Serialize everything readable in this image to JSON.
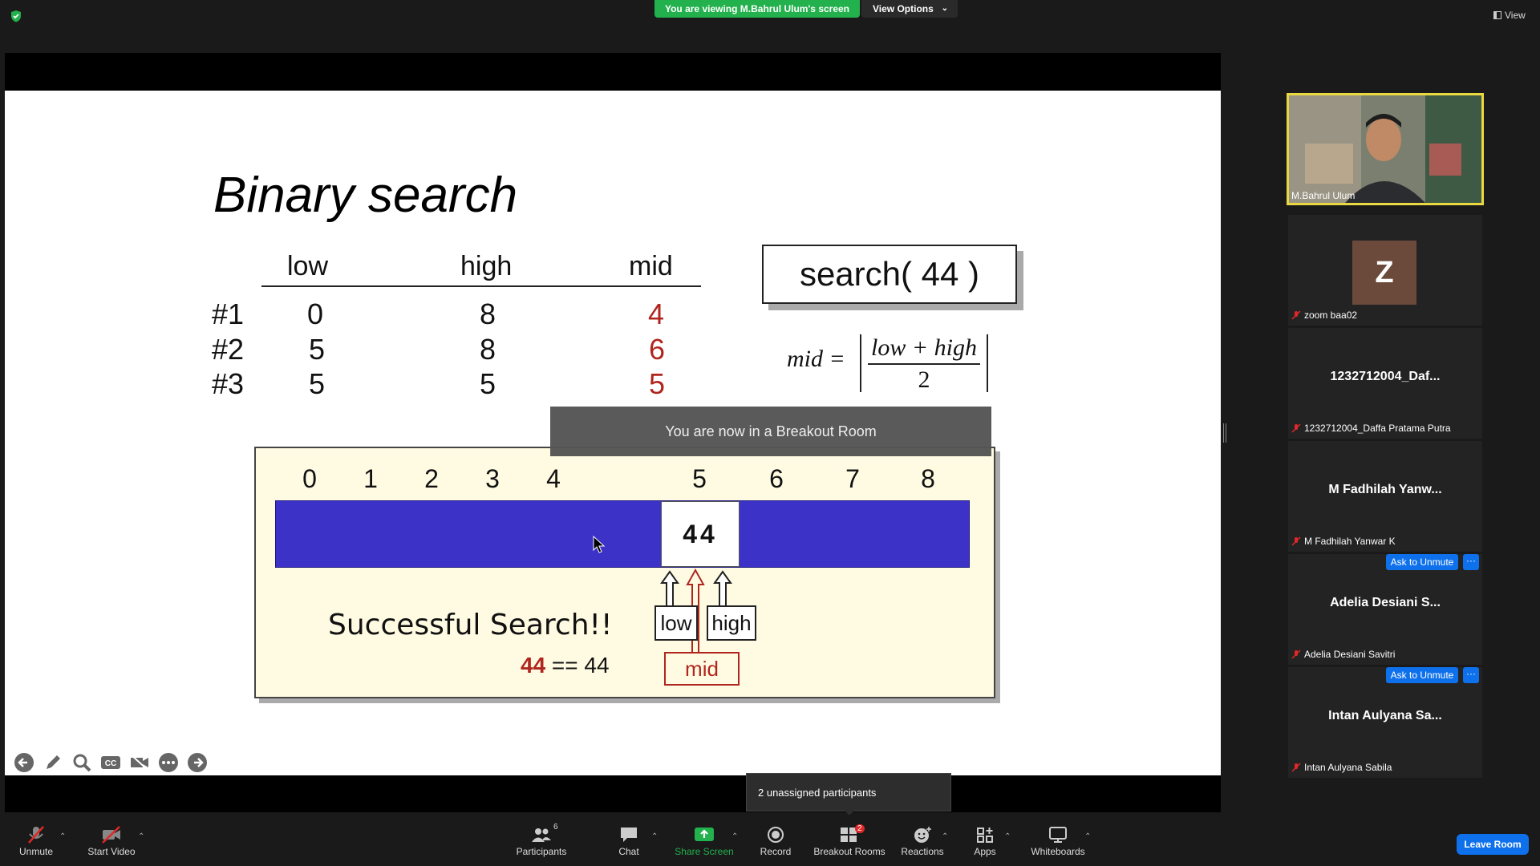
{
  "top": {
    "viewing_banner": "You are viewing M.Bahrul Ulum's screen",
    "view_options": "View Options",
    "view_button": "View"
  },
  "slide": {
    "title": "Binary search",
    "headers": [
      "low",
      "high",
      "mid"
    ],
    "rows": [
      {
        "label": "#1",
        "low": "0",
        "high": "8",
        "mid": "4"
      },
      {
        "label": "#2",
        "low": "5",
        "high": "8",
        "mid": "6"
      },
      {
        "label": "#3",
        "low": "5",
        "high": "5",
        "mid": "5"
      }
    ],
    "search_call": "search( 44 )",
    "formula": {
      "lhs": "mid =",
      "numerator": "low + high",
      "denominator": "2"
    },
    "indices": [
      "0",
      "1",
      "2",
      "3",
      "4",
      "5",
      "6",
      "7",
      "8"
    ],
    "found_value": "44",
    "success_text": "Successful Search!!",
    "compare_left": "44",
    "compare_rest": " == 44",
    "pointer_low": "low",
    "pointer_high": "high",
    "pointer_mid": "mid",
    "accent_red": "#b0261f",
    "array_blue": "#3c32c8"
  },
  "breakout_toast": "You are now in a Breakout Room",
  "slide_tools": [
    "back-arrow-icon",
    "pen-icon",
    "zoom-icon",
    "cc-icon",
    "video-off-icon",
    "more-icon",
    "forward-arrow-icon"
  ],
  "participants": {
    "video_name": "M.Bahrul Ulum",
    "tiles": [
      {
        "avatar_letter": "Z",
        "label": "zoom baa02"
      },
      {
        "center": "1232712004_Daf...",
        "label": "1232712004_Daffa Pratama Putra"
      },
      {
        "center": "M Fadhilah Yanw...",
        "label": "M Fadhilah Yanwar K"
      },
      {
        "center": "Adelia Desiani S...",
        "label": "Adelia Desiani Savitri"
      },
      {
        "center": "Intan Aulyana Sa...",
        "label": "Intan Aulyana Sabila"
      }
    ],
    "ask_to_unmute": "Ask to Unmute",
    "more": "···"
  },
  "unassigned_tooltip": "2 unassigned participants",
  "toolbar": {
    "unmute": "Unmute",
    "start_video": "Start Video",
    "participants": "Participants",
    "participants_count": "6",
    "chat": "Chat",
    "share_screen": "Share Screen",
    "record": "Record",
    "breakout_rooms": "Breakout Rooms",
    "breakout_badge": "2",
    "reactions": "Reactions",
    "apps": "Apps",
    "whiteboards": "Whiteboards",
    "leave_room": "Leave Room",
    "share_green": "#23b14d"
  }
}
